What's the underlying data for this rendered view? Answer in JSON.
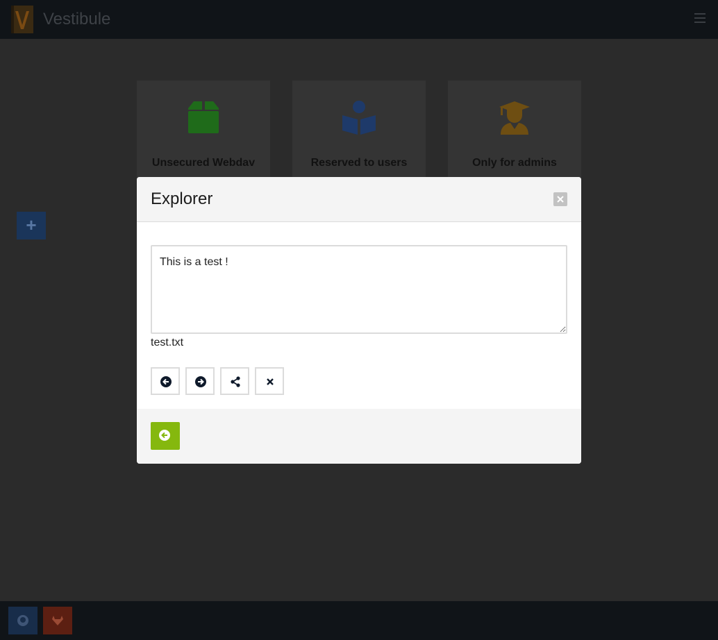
{
  "app": {
    "title": "Vestibule"
  },
  "cards": [
    {
      "title": "Unsecured Webdav",
      "icon": "box-icon",
      "color": "#1f6b1a"
    },
    {
      "title": "Reserved to users",
      "icon": "book-reader-icon",
      "color": "#1e3a6a"
    },
    {
      "title": "Only for admins",
      "icon": "user-graduate-icon",
      "color": "#6e4e12"
    }
  ],
  "add_button": {
    "label": "+"
  },
  "modal": {
    "title": "Explorer",
    "content": "This is a test !",
    "filename": "test.txt",
    "toolbar": [
      "previous-icon",
      "next-icon",
      "share-icon",
      "close-icon"
    ],
    "accent": "#85b80e"
  },
  "footer": {
    "buttons": [
      "github-icon",
      "gitlab-icon"
    ]
  }
}
